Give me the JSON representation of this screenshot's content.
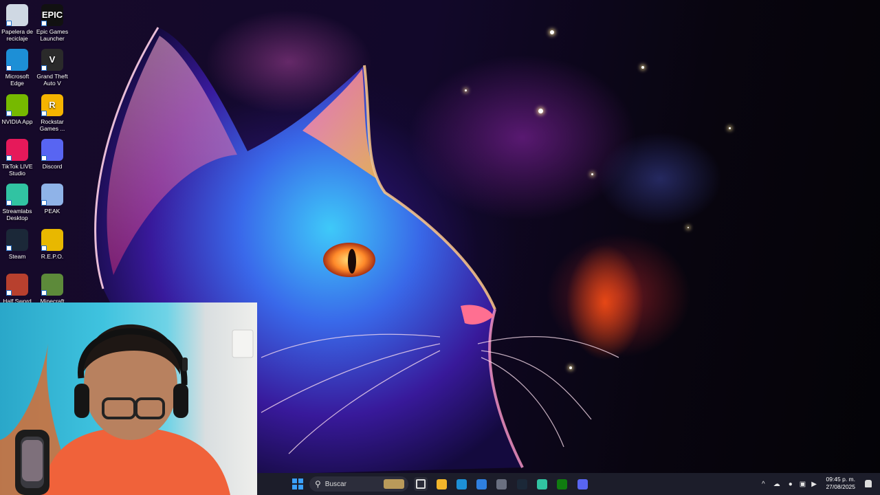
{
  "desktop": {
    "icons": [
      {
        "label": "Papelera de reciclaje",
        "icon": "recycle-bin-icon",
        "color": "#cfd8e3"
      },
      {
        "label": "Epic Games Launcher",
        "icon": "epic-games-icon",
        "color": "#111111",
        "glyph": "EPIC"
      },
      {
        "label": "Microsoft Edge",
        "icon": "edge-icon",
        "color": "#1d8fd6"
      },
      {
        "label": "Grand Theft Auto V",
        "icon": "gta-v-icon",
        "color": "#2a2a2a",
        "glyph": "V"
      },
      {
        "label": "NVIDIA App",
        "icon": "nvidia-icon",
        "color": "#76b900"
      },
      {
        "label": "Rockstar Games ...",
        "icon": "rockstar-icon",
        "color": "#f5b400",
        "glyph": "R"
      },
      {
        "label": "TikTok LIVE Studio",
        "icon": "tiktok-live-icon",
        "color": "#e6195a"
      },
      {
        "label": "Discord",
        "icon": "discord-icon",
        "color": "#5865f2"
      },
      {
        "label": "Streamlabs Desktop",
        "icon": "streamlabs-icon",
        "color": "#31c3a2"
      },
      {
        "label": "PEAK",
        "icon": "peak-icon",
        "color": "#8fb3e8"
      },
      {
        "label": "Steam",
        "icon": "steam-icon",
        "color": "#1b2838"
      },
      {
        "label": "R.E.P.O.",
        "icon": "repo-icon",
        "color": "#e8b800"
      },
      {
        "label": "Half Sword",
        "icon": "half-sword-icon",
        "color": "#b8402e"
      },
      {
        "label": "Minecraft",
        "icon": "minecraft-icon",
        "color": "#5d8a3a"
      }
    ]
  },
  "taskbar": {
    "search_placeholder": "Buscar",
    "apps": [
      {
        "icon": "file-explorer-icon",
        "color": "#f2b52b"
      },
      {
        "icon": "edge-icon",
        "color": "#1d8fd6"
      },
      {
        "icon": "microsoft-store-icon",
        "color": "#2f7fe0"
      },
      {
        "icon": "cube-app-icon",
        "color": "#6a6f80"
      },
      {
        "icon": "steam-icon",
        "color": "#1b2838"
      },
      {
        "icon": "streamlabs-icon",
        "color": "#31c3a2"
      },
      {
        "icon": "xbox-icon",
        "color": "#107c10"
      },
      {
        "icon": "discord-icon",
        "color": "#5865f2"
      }
    ],
    "time": "09:45 p. m.",
    "date": "27/08/2025"
  }
}
